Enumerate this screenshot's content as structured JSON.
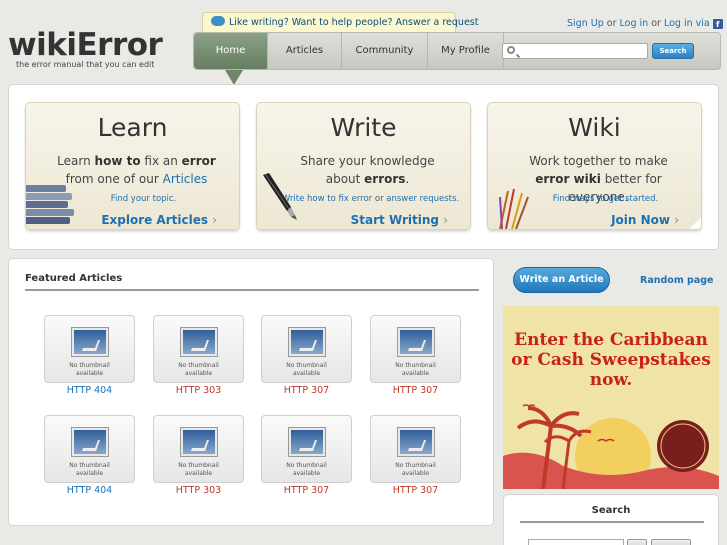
{
  "header": {
    "logo": "wikiError",
    "tagline": "the error manual that you can edit",
    "promo": "Like writing? Want to help people? Answer a request",
    "nav": {
      "home": "Home",
      "articles": "Articles",
      "community": "Community",
      "profile": "My Profile"
    },
    "search_button": "Search",
    "search_value": "",
    "user_links": {
      "signup": "Sign Up",
      "or1": "or",
      "login": "Log in",
      "or2": "or",
      "login_via": "Log in via"
    },
    "fb_icon": "f"
  },
  "hero": {
    "learn": {
      "title": "Learn",
      "desc_1": "Learn",
      "desc_2": "how to",
      "desc_3": "fix an",
      "desc_4": "error",
      "desc_5": "from one of our",
      "desc_6": "Articles",
      "small": "Find your topic.",
      "cta": "Explore Articles"
    },
    "write": {
      "title": "Write",
      "desc_1": "Share your knowledge",
      "desc_2": "about",
      "desc_3": "errors",
      "desc_4": ".",
      "small_1": "Write how to fix error",
      "small_2": "or",
      "small_3": "answer requests.",
      "cta": "Start Writing"
    },
    "wiki": {
      "title": "Wiki",
      "desc_1": "Work together to make",
      "desc_2": "error wiki",
      "desc_3": "better for everyone.",
      "small": "Find ways to get started.",
      "cta": "Join Now"
    },
    "cta_arrow": "›"
  },
  "featured": {
    "title": "Featured Articles",
    "thumb_caption_1": "No thumbnail",
    "thumb_caption_2": "available",
    "items": [
      {
        "label": "HTTP 404",
        "color": "#1d70b0"
      },
      {
        "label": "HTTP 303",
        "color": "#c0392b"
      },
      {
        "label": "HTTP 307",
        "color": "#c0392b"
      },
      {
        "label": "HTTP 307",
        "color": "#c0392b"
      },
      {
        "label": "HTTP 404",
        "color": "#1d70b0"
      },
      {
        "label": "HTTP 303",
        "color": "#c0392b"
      },
      {
        "label": "HTTP 307",
        "color": "#c0392b"
      },
      {
        "label": "HTTP 307",
        "color": "#c0392b"
      }
    ]
  },
  "sidebar": {
    "write_button": "Write an Article",
    "random_link": "Random page",
    "ad_line_1": "Enter the Caribbean",
    "ad_line_2": "or Cash Sweepstakes",
    "ad_line_3": "now.",
    "search_title": "Search"
  },
  "colors": {
    "link": "#1d70b0",
    "nav_active": "#6e8569",
    "ad_red": "#c8201a"
  }
}
